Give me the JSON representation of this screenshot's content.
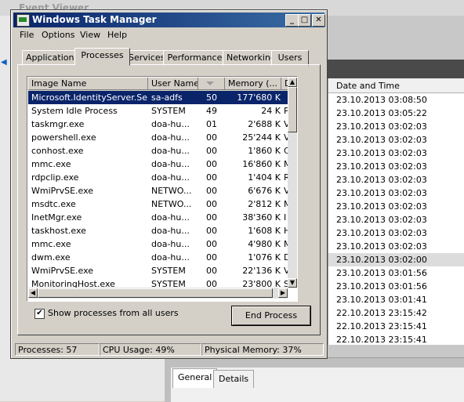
{
  "event_viewer": {
    "title": "Event Viewer",
    "column_header": "Date and Time",
    "dates": [
      "23.10.2013 03:08:50",
      "23.10.2013 03:05:22",
      "23.10.2013 03:02:03",
      "23.10.2013 03:02:03",
      "23.10.2013 03:02:03",
      "23.10.2013 03:02:03",
      "23.10.2013 03:02:03",
      "23.10.2013 03:02:03",
      "23.10.2013 03:02:03",
      "23.10.2013 03:02:03",
      "23.10.2013 03:02:03",
      "23.10.2013 03:02:03",
      "23.10.2013 03:02:00",
      "23.10.2013 03:01:56",
      "23.10.2013 03:01:56",
      "23.10.2013 03:01:41",
      "22.10.2013 23:15:42",
      "22.10.2013 23:15:41",
      "22.10.2013 23:15:41"
    ],
    "selected_index": 12,
    "tabs": {
      "general": "General",
      "details": "Details"
    }
  },
  "task_manager": {
    "title": "Windows Task Manager",
    "menu": {
      "file": "File",
      "options": "Options",
      "view": "View",
      "help": "Help"
    },
    "tabs": {
      "applications": "Applications",
      "processes": "Processes",
      "services": "Services",
      "performance": "Performance",
      "networking": "Networking",
      "users": "Users"
    },
    "active_tab": "Processes",
    "columns": {
      "image_name": "Image Name",
      "user_name": "User Name",
      "cpu": "",
      "memory": "Memory (...",
      "description": "D"
    },
    "processes": [
      {
        "name": "Microsoft.IdentityServer.Se...",
        "user": "sa-adfs",
        "cpu": "50",
        "memory": "177'680 K",
        "desc": ""
      },
      {
        "name": "System Idle Process",
        "user": "SYSTEM",
        "cpu": "49",
        "memory": "24 K",
        "desc": "P"
      },
      {
        "name": "taskmgr.exe",
        "user": "doa-hu...",
        "cpu": "01",
        "memory": "2'688 K",
        "desc": "V"
      },
      {
        "name": "powershell.exe",
        "user": "doa-hu...",
        "cpu": "00",
        "memory": "25'244 K",
        "desc": "V"
      },
      {
        "name": "conhost.exe",
        "user": "doa-hu...",
        "cpu": "00",
        "memory": "1'860 K",
        "desc": "C"
      },
      {
        "name": "mmc.exe",
        "user": "doa-hu...",
        "cpu": "00",
        "memory": "16'860 K",
        "desc": "M"
      },
      {
        "name": "rdpclip.exe",
        "user": "doa-hu...",
        "cpu": "00",
        "memory": "1'404 K",
        "desc": "R"
      },
      {
        "name": "WmiPrvSE.exe",
        "user": "NETWO...",
        "cpu": "00",
        "memory": "6'676 K",
        "desc": "V"
      },
      {
        "name": "msdtc.exe",
        "user": "NETWO...",
        "cpu": "00",
        "memory": "2'812 K",
        "desc": "M"
      },
      {
        "name": "InetMgr.exe",
        "user": "doa-hu...",
        "cpu": "00",
        "memory": "38'360 K",
        "desc": "I"
      },
      {
        "name": "taskhost.exe",
        "user": "doa-hu...",
        "cpu": "00",
        "memory": "1'608 K",
        "desc": "H"
      },
      {
        "name": "mmc.exe",
        "user": "doa-hu...",
        "cpu": "00",
        "memory": "4'980 K",
        "desc": "M"
      },
      {
        "name": "dwm.exe",
        "user": "doa-hu...",
        "cpu": "00",
        "memory": "1'076 K",
        "desc": "D"
      },
      {
        "name": "WmiPrvSE.exe",
        "user": "SYSTEM",
        "cpu": "00",
        "memory": "22'136 K",
        "desc": "V"
      },
      {
        "name": "MonitoringHost.exe",
        "user": "SYSTEM",
        "cpu": "00",
        "memory": "23'800 K",
        "desc": "S"
      }
    ],
    "selected_process_index": 0,
    "show_all_users": {
      "label": "Show processes from all users",
      "checked": true
    },
    "end_process_label": "End Process",
    "status": {
      "processes": "Processes: 57",
      "cpu_usage": "CPU Usage: 49%",
      "physical_memory": "Physical Memory: 37%"
    }
  }
}
